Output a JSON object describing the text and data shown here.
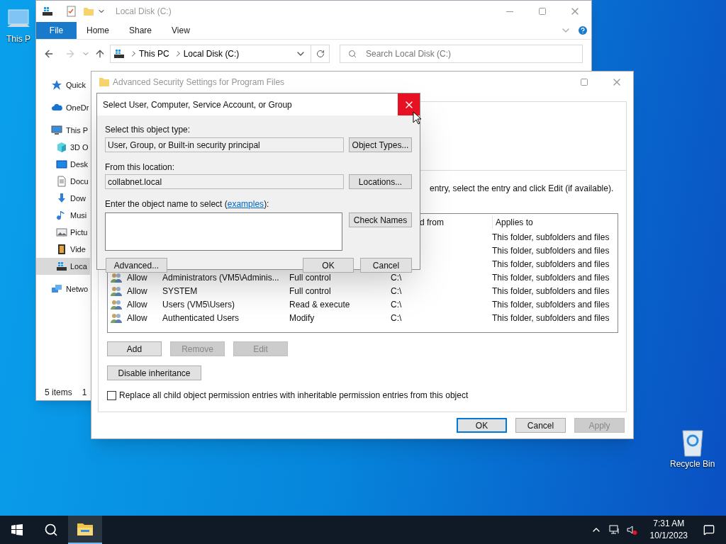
{
  "desktop": {
    "icons": [
      {
        "kind": "computer",
        "label": "This P"
      },
      {
        "kind": "recycle",
        "label": "Recycle Bin"
      }
    ]
  },
  "explorer": {
    "title": "Local Disk (C:)",
    "ribbon_tabs": [
      {
        "kind": "file",
        "label": "File"
      },
      {
        "kind": "tab",
        "label": "Home"
      },
      {
        "kind": "tab",
        "label": "Share"
      },
      {
        "kind": "tab",
        "label": "View"
      }
    ],
    "breadcrumbs": [
      "This PC",
      "Local Disk (C:)"
    ],
    "search": {
      "placeholder": "Search Local Disk (C:)"
    },
    "nav_items": [
      {
        "kind": "quick",
        "label": "Quick",
        "selected": false
      },
      {
        "kind": "cloud",
        "label": "OneDr",
        "selected": false
      },
      {
        "kind": "pc",
        "label": "This P",
        "selected": false,
        "children": [
          {
            "kind": "cube",
            "label": "3D O",
            "selected": false
          },
          {
            "kind": "desktop",
            "label": "Desk",
            "selected": false
          },
          {
            "kind": "document",
            "label": "Docu",
            "selected": false
          },
          {
            "kind": "download",
            "label": "Dow",
            "selected": false
          },
          {
            "kind": "music",
            "label": "Musi",
            "selected": false
          },
          {
            "kind": "picture",
            "label": "Pictu",
            "selected": false
          },
          {
            "kind": "video",
            "label": "Vide",
            "selected": false
          },
          {
            "kind": "disk",
            "label": "Loca",
            "selected": true
          }
        ]
      },
      {
        "kind": "network",
        "label": "Netwo",
        "selected": false
      }
    ],
    "status": [
      "5 items",
      "1"
    ]
  },
  "advanced": {
    "title": "Advanced Security Settings for Program Files",
    "instruction": "entry, select the entry and click Edit (if available).",
    "columns": [
      "d from",
      "Applies to"
    ],
    "entries": [
      {
        "applies_to": "This folder, subfolders and files"
      },
      {
        "applies_to": "This folder, subfolders and files"
      },
      {
        "applies_to": "This folder, subfolders and files"
      },
      {
        "type": "Allow",
        "principal": "Administrators (VM5\\Adminis...",
        "access": "Full control",
        "inherited": "C:\\",
        "applies_to": "This folder, subfolders and files"
      },
      {
        "type": "Allow",
        "principal": "SYSTEM",
        "access": "Full control",
        "inherited": "C:\\",
        "applies_to": "This folder, subfolders and files"
      },
      {
        "type": "Allow",
        "principal": "Users (VM5\\Users)",
        "access": "Read & execute",
        "inherited": "C:\\",
        "applies_to": "This folder, subfolders and files"
      },
      {
        "type": "Allow",
        "principal": "Authenticated Users",
        "access": "Modify",
        "inherited": "C:\\",
        "applies_to": "This folder, subfolders and files"
      }
    ],
    "entry_buttons": [
      {
        "label": "Add",
        "disabled": false
      },
      {
        "label": "Remove",
        "disabled": true
      },
      {
        "label": "Edit",
        "disabled": true
      }
    ],
    "inheritance_button": "Disable inheritance",
    "replace_checkbox": {
      "label": "Replace all child object permission entries with inheritable permission entries from this object",
      "checked": false
    },
    "footer_buttons": [
      {
        "label": "OK",
        "disabled": false,
        "default": true
      },
      {
        "label": "Cancel",
        "disabled": false,
        "default": false
      },
      {
        "label": "Apply",
        "disabled": true,
        "default": false
      }
    ]
  },
  "select_dialog": {
    "title": "Select User, Computer, Service Account, or Group",
    "object_type_label": "Select this object type:",
    "object_type": "User, Group, or Built-in security principal",
    "object_types_button": "Object Types...",
    "location_label": "From this location:",
    "location": "collabnet.local",
    "locations_button": "Locations...",
    "name_label_before": "Enter the object name to select (",
    "name_label_link": "examples",
    "name_label_after": "):",
    "check_names_button": "Check Names",
    "advanced_button": "Advanced...",
    "ok_button": "OK",
    "cancel_button": "Cancel"
  },
  "taskbar": {
    "apps": [
      {
        "kind": "explorer",
        "active": true
      }
    ],
    "time": "7:31 AM",
    "date": "10/1/2023",
    "volume_muted": true
  }
}
